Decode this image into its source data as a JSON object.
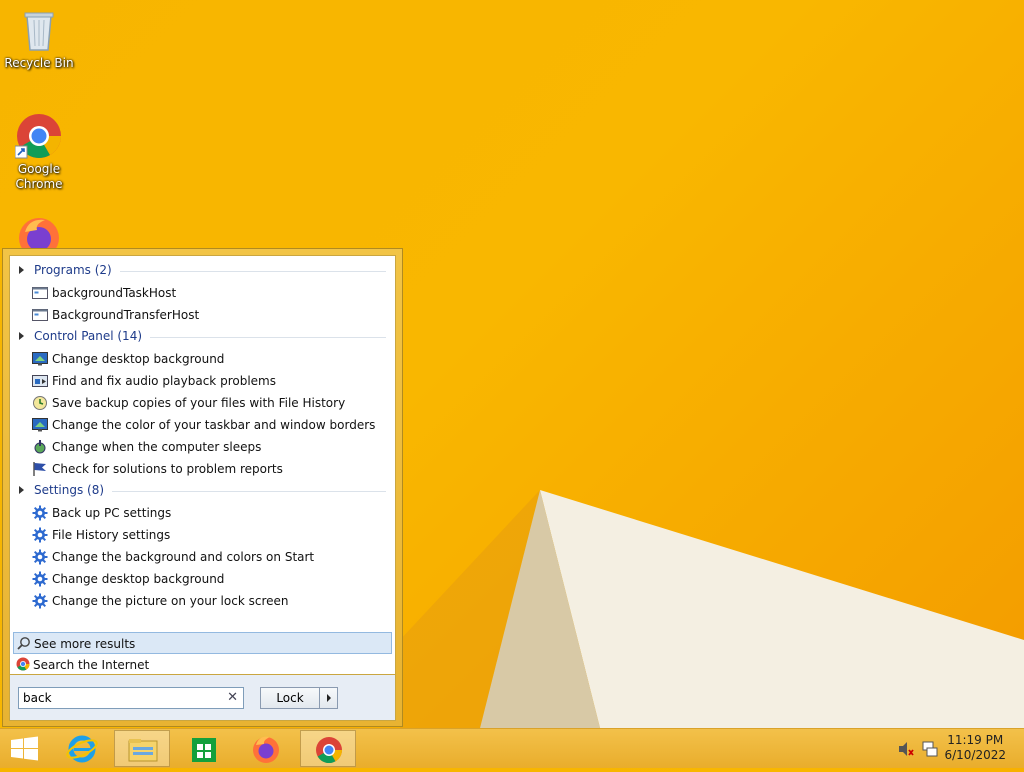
{
  "desktop": {
    "icons": [
      {
        "label": "Recycle Bin"
      },
      {
        "label": "Google\nChrome"
      },
      {
        "label": ""
      }
    ]
  },
  "start_menu": {
    "groups": [
      {
        "title": "Programs (2)",
        "items": [
          {
            "label": "backgroundTaskHost",
            "icon": "app-window-icon"
          },
          {
            "label": "BackgroundTransferHost",
            "icon": "app-window-icon"
          }
        ]
      },
      {
        "title": "Control Panel (14)",
        "items": [
          {
            "label": "Change desktop background",
            "icon": "monitor-icon"
          },
          {
            "label": "Find and fix audio playback problems",
            "icon": "troubleshoot-icon"
          },
          {
            "label": "Save backup copies of your files with File History",
            "icon": "file-history-icon"
          },
          {
            "label": "Change the color of your taskbar and window borders",
            "icon": "monitor-icon"
          },
          {
            "label": "Change when the computer sleeps",
            "icon": "power-icon"
          },
          {
            "label": "Check for solutions to problem reports",
            "icon": "flag-icon"
          }
        ]
      },
      {
        "title": "Settings (8)",
        "items": [
          {
            "label": "Back up PC settings",
            "icon": "gear-icon"
          },
          {
            "label": "File History settings",
            "icon": "gear-icon"
          },
          {
            "label": "Change the background and colors on Start",
            "icon": "gear-icon"
          },
          {
            "label": "Change desktop background",
            "icon": "gear-icon"
          },
          {
            "label": "Change the picture on your lock screen",
            "icon": "gear-icon"
          }
        ]
      }
    ],
    "see_more": "See more results",
    "search_internet": "Search the Internet",
    "search_value": "back",
    "lock_label": "Lock"
  },
  "taskbar": {
    "clock_time": "11:19 PM",
    "clock_date": "6/10/2022"
  },
  "colors": {
    "wallpaper": "#f7b500",
    "taskbar": "#efb83a",
    "group_header": "#1e3b8a"
  }
}
